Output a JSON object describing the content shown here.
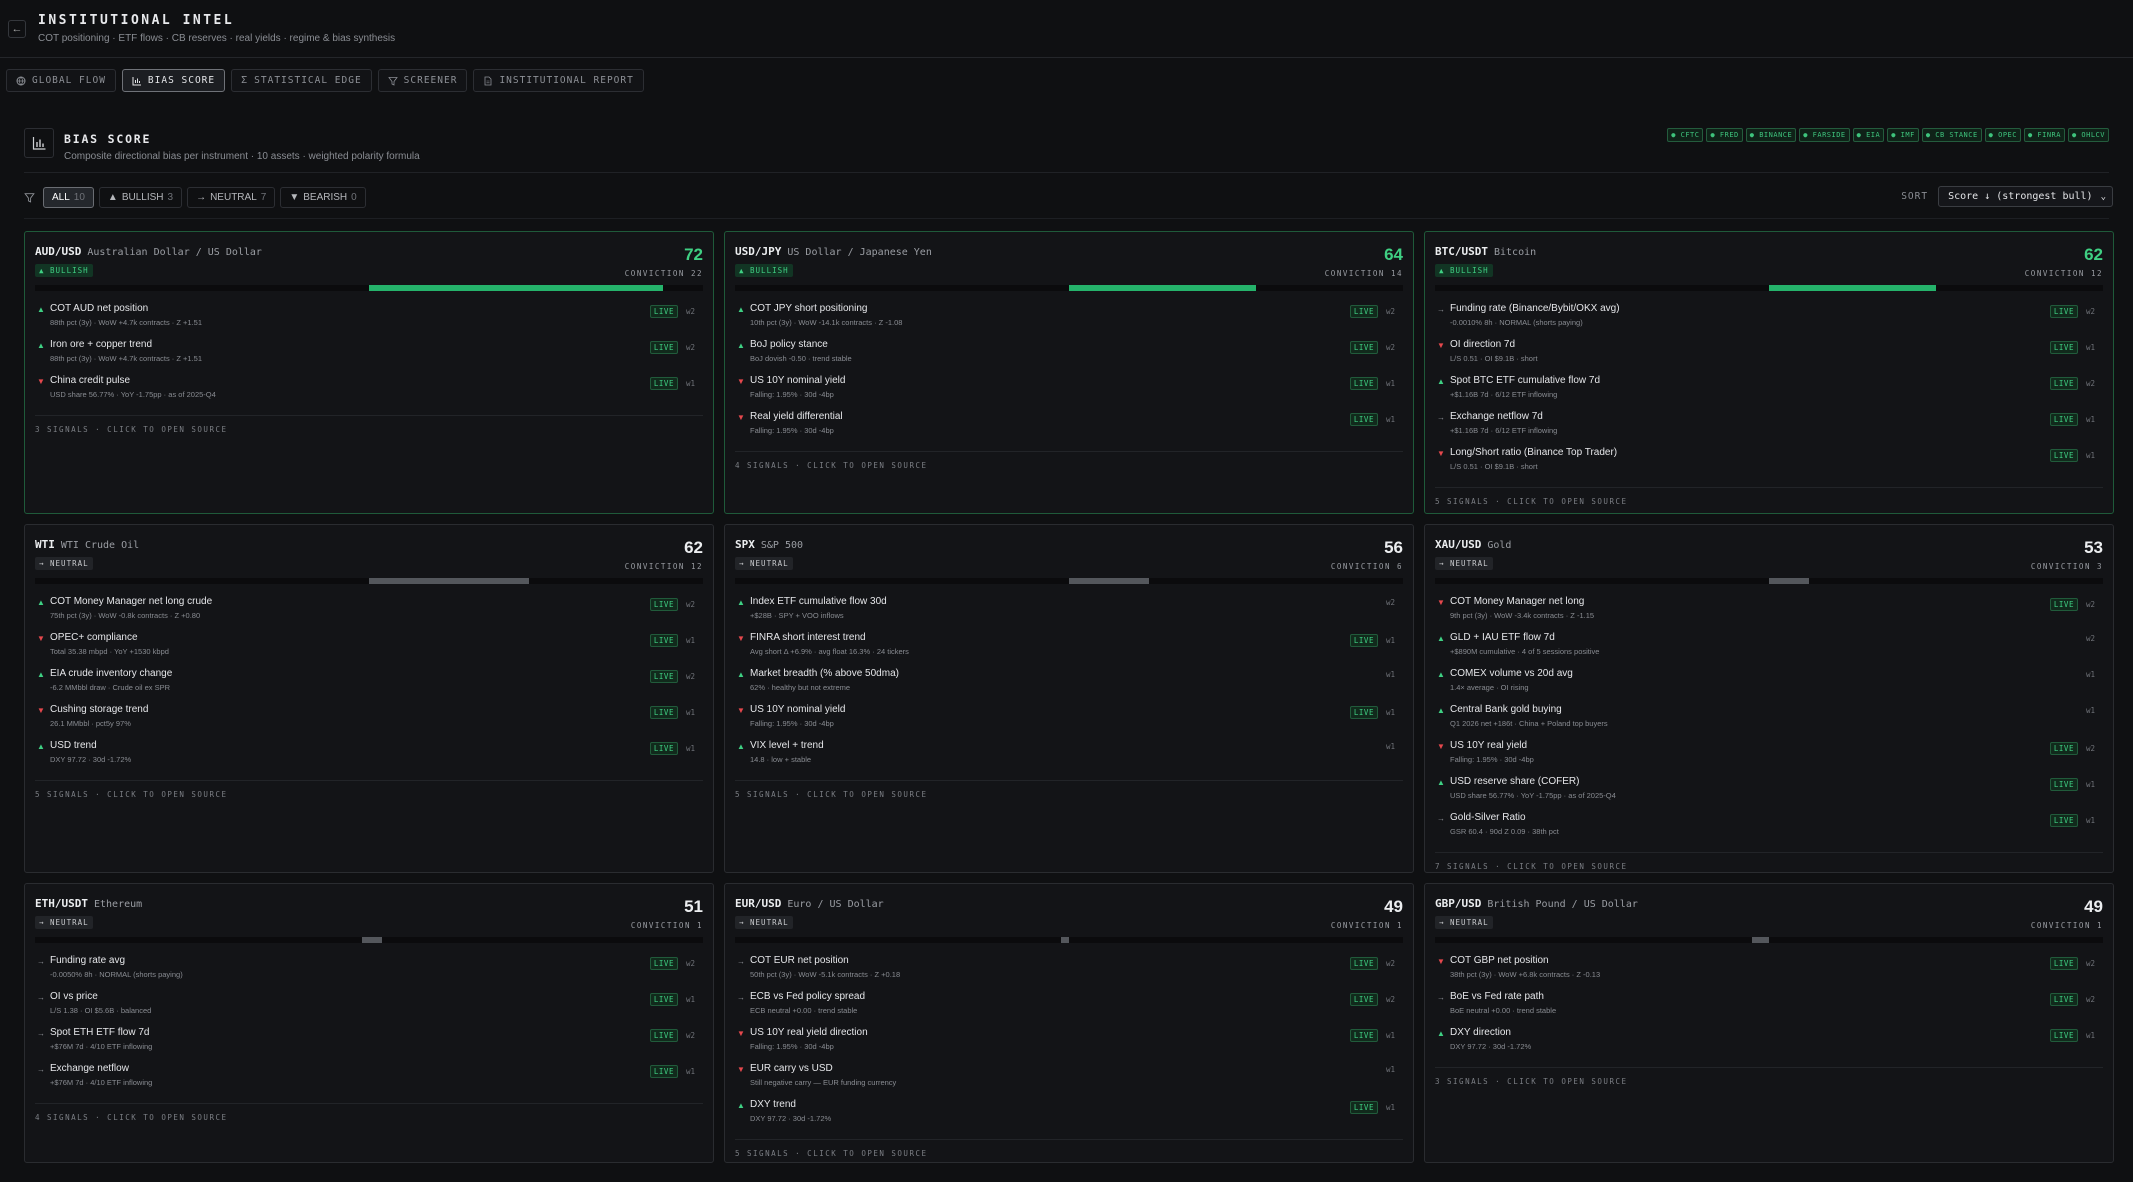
{
  "header": {
    "title": "INSTITUTIONAL INTEL",
    "subtitle": "COT positioning · ETF flows · CB reserves · real yields · regime & bias synthesis"
  },
  "tabs": [
    {
      "label": "GLOBAL FLOW",
      "icon": "globe-icon"
    },
    {
      "label": "BIAS SCORE",
      "icon": "bar-chart-icon"
    },
    {
      "label": "STATISTICAL EDGE",
      "icon": "sigma-icon"
    },
    {
      "label": "SCREENER",
      "icon": "filter-icon"
    },
    {
      "label": "INSTITUTIONAL REPORT",
      "icon": "document-icon"
    }
  ],
  "section": {
    "title": "BIAS SCORE",
    "subtitle": "Composite directional bias per instrument · 10 assets · weighted polarity formula"
  },
  "sources": [
    "● CFTC",
    "● FRED",
    "● BINANCE",
    "● FARSIDE",
    "● EIA",
    "● IMF",
    "● CB STANCE",
    "● OPEC",
    "● FINRA",
    "● OHLCV"
  ],
  "filters": [
    {
      "label": "ALL",
      "count": "10",
      "prefix": ""
    },
    {
      "label": "BULLISH",
      "count": "3",
      "prefix": "▲"
    },
    {
      "label": "NEUTRAL",
      "count": "7",
      "prefix": "→"
    },
    {
      "label": "BEARISH",
      "count": "0",
      "prefix": "▼"
    }
  ],
  "sort": {
    "label": "SORT",
    "value": "Score ↓ (strongest bull)"
  },
  "colors": {
    "bull": "#3fd083",
    "bear": "#e5484d",
    "neutral": "#8a8d93"
  },
  "cards": [
    {
      "sym": "AUD/USD",
      "desc": "Australian Dollar / US Dollar",
      "bias": "▲ BULLISH",
      "score": "72",
      "conviction": "CONVICTION 22",
      "fill": [
        0.5,
        0.94
      ],
      "signals": [
        {
          "dir": "up",
          "name": "COT AUD net position",
          "meta": "88th pct (3y) · WoW +4.7k contracts · Z +1.51",
          "live": "LIVE",
          "w": "w2"
        },
        {
          "dir": "up",
          "name": "Iron ore + copper trend",
          "meta": "88th pct (3y) · WoW +4.7k contracts · Z +1.51",
          "live": "LIVE",
          "w": "w2"
        },
        {
          "dir": "dn",
          "name": "China credit pulse",
          "meta": "USD share 56.77% · YoY -1.75pp · as of 2025-Q4",
          "live": "LIVE",
          "w": "w1"
        }
      ],
      "footer": "3 SIGNALS · CLICK TO OPEN SOURCE"
    },
    {
      "sym": "USD/JPY",
      "desc": "US Dollar / Japanese Yen",
      "bias": "▲ BULLISH",
      "score": "64",
      "conviction": "CONVICTION 14",
      "fill": [
        0.5,
        0.78
      ],
      "signals": [
        {
          "dir": "up",
          "name": "COT JPY short positioning",
          "meta": "10th pct (3y) · WoW -14.1k contracts · Z -1.08",
          "live": "LIVE",
          "w": "w2"
        },
        {
          "dir": "up",
          "name": "BoJ policy stance",
          "meta": "BoJ dovish -0.50 · trend stable",
          "live": "LIVE",
          "w": "w2"
        },
        {
          "dir": "dn",
          "name": "US 10Y nominal yield",
          "meta": "Falling: 1.95% · 30d -4bp",
          "live": "LIVE",
          "w": "w1"
        },
        {
          "dir": "dn",
          "name": "Real yield differential",
          "meta": "Falling: 1.95% · 30d -4bp",
          "live": "LIVE",
          "w": "w1"
        }
      ],
      "footer": "4 SIGNALS · CLICK TO OPEN SOURCE"
    },
    {
      "sym": "BTC/USDT",
      "desc": "Bitcoin",
      "bias": "▲ BULLISH",
      "score": "62",
      "conviction": "CONVICTION 12",
      "fill": [
        0.5,
        0.75
      ],
      "signals": [
        {
          "dir": "fl",
          "name": "Funding rate (Binance/Bybit/OKX avg)",
          "meta": "-0.0010% 8h · NORMAL (shorts paying)",
          "live": "LIVE",
          "w": "w2"
        },
        {
          "dir": "dn",
          "name": "OI direction 7d",
          "meta": "L/S 0.51 · OI $9.1B · short",
          "live": "LIVE",
          "w": "w1"
        },
        {
          "dir": "up",
          "name": "Spot BTC ETF cumulative flow 7d",
          "meta": "+$1.16B 7d · 6/12 ETF inflowing",
          "live": "LIVE",
          "w": "w2"
        },
        {
          "dir": "fl",
          "name": "Exchange netflow 7d",
          "meta": "+$1.16B 7d · 6/12 ETF inflowing",
          "live": "LIVE",
          "w": "w1"
        },
        {
          "dir": "dn",
          "name": "Long/Short ratio (Binance Top Trader)",
          "meta": "L/S 0.51 · OI $9.1B · short",
          "live": "LIVE",
          "w": "w1"
        }
      ],
      "footer": "5 SIGNALS · CLICK TO OPEN SOURCE"
    },
    {
      "sym": "WTI",
      "desc": "WTI Crude Oil",
      "bias": "→ NEUTRAL",
      "score": "62",
      "conviction": "CONVICTION 12",
      "fill": [
        0.5,
        0.74
      ],
      "signals": [
        {
          "dir": "up",
          "name": "COT Money Manager net long crude",
          "meta": "75th pct (3y) · WoW -0.8k contracts · Z +0.80",
          "live": "LIVE",
          "w": "w2"
        },
        {
          "dir": "dn",
          "name": "OPEC+ compliance",
          "meta": "Total 35.38 mbpd · YoY +1530 kbpd",
          "live": "LIVE",
          "w": "w1"
        },
        {
          "dir": "up",
          "name": "EIA crude inventory change",
          "meta": "-6.2 MMbbl draw · Crude oil ex SPR",
          "live": "LIVE",
          "w": "w2"
        },
        {
          "dir": "dn",
          "name": "Cushing storage trend",
          "meta": "26.1 MMbbl · pct5y 97%",
          "live": "LIVE",
          "w": "w1"
        },
        {
          "dir": "up",
          "name": "USD trend",
          "meta": "DXY 97.72 · 30d -1.72%",
          "live": "LIVE",
          "w": "w1"
        }
      ],
      "footer": "5 SIGNALS · CLICK TO OPEN SOURCE"
    },
    {
      "sym": "SPX",
      "desc": "S&P 500",
      "bias": "→ NEUTRAL",
      "score": "56",
      "conviction": "CONVICTION 6",
      "fill": [
        0.5,
        0.62
      ],
      "signals": [
        {
          "dir": "up",
          "name": "Index ETF cumulative flow 30d",
          "meta": "+$28B · SPY + VOO inflows",
          "live": "",
          "w": "w2"
        },
        {
          "dir": "dn",
          "name": "FINRA short interest trend",
          "meta": "Avg short Δ +6.9% · avg float 16.3% · 24 tickers",
          "live": "LIVE",
          "w": "w1"
        },
        {
          "dir": "up",
          "name": "Market breadth (% above 50dma)",
          "meta": "62% · healthy but not extreme",
          "live": "",
          "w": "w1"
        },
        {
          "dir": "dn",
          "name": "US 10Y nominal yield",
          "meta": "Falling: 1.95% · 30d -4bp",
          "live": "LIVE",
          "w": "w1"
        },
        {
          "dir": "up",
          "name": "VIX level + trend",
          "meta": "14.8 · low + stable",
          "live": "",
          "w": "w1"
        }
      ],
      "footer": "5 SIGNALS · CLICK TO OPEN SOURCE"
    },
    {
      "sym": "XAU/USD",
      "desc": "Gold",
      "bias": "→ NEUTRAL",
      "score": "53",
      "conviction": "CONVICTION 3",
      "fill": [
        0.5,
        0.56
      ],
      "signals": [
        {
          "dir": "dn",
          "name": "COT Money Manager net long",
          "meta": "9th pct (3y) · WoW -3.4k contracts · Z -1.15",
          "live": "LIVE",
          "w": "w2"
        },
        {
          "dir": "up",
          "name": "GLD + IAU ETF flow 7d",
          "meta": "+$890M cumulative · 4 of 5 sessions positive",
          "live": "",
          "w": "w2"
        },
        {
          "dir": "up",
          "name": "COMEX volume vs 20d avg",
          "meta": "1.4× average · OI rising",
          "live": "",
          "w": "w1"
        },
        {
          "dir": "up",
          "name": "Central Bank gold buying",
          "meta": "Q1 2026 net +186t · China + Poland top buyers",
          "live": "",
          "w": "w1"
        },
        {
          "dir": "dn",
          "name": "US 10Y real yield",
          "meta": "Falling: 1.95% · 30d -4bp",
          "live": "LIVE",
          "w": "w2"
        },
        {
          "dir": "up",
          "name": "USD reserve share (COFER)",
          "meta": "USD share 56.77% · YoY -1.75pp · as of 2025-Q4",
          "live": "LIVE",
          "w": "w1"
        },
        {
          "dir": "fl",
          "name": "Gold-Silver Ratio",
          "meta": "GSR 60.4 · 90d Z 0.09 · 38th pct",
          "live": "LIVE",
          "w": "w1"
        }
      ],
      "footer": "7 SIGNALS · CLICK TO OPEN SOURCE"
    },
    {
      "sym": "ETH/USDT",
      "desc": "Ethereum",
      "bias": "→ NEUTRAL",
      "score": "51",
      "conviction": "CONVICTION 1",
      "fill": [
        0.49,
        0.52
      ],
      "signals": [
        {
          "dir": "fl",
          "name": "Funding rate avg",
          "meta": "-0.0050% 8h · NORMAL (shorts paying)",
          "live": "LIVE",
          "w": "w2"
        },
        {
          "dir": "fl",
          "name": "OI vs price",
          "meta": "L/S 1.38 · OI $5.6B · balanced",
          "live": "LIVE",
          "w": "w1"
        },
        {
          "dir": "fl",
          "name": "Spot ETH ETF flow 7d",
          "meta": "+$76M 7d · 4/10 ETF inflowing",
          "live": "LIVE",
          "w": "w2"
        },
        {
          "dir": "fl",
          "name": "Exchange netflow",
          "meta": "+$76M 7d · 4/10 ETF inflowing",
          "live": "LIVE",
          "w": "w1"
        }
      ],
      "footer": "4 SIGNALS · CLICK TO OPEN SOURCE"
    },
    {
      "sym": "EUR/USD",
      "desc": "Euro / US Dollar",
      "bias": "→ NEUTRAL",
      "score": "49",
      "conviction": "CONVICTION 1",
      "fill": [
        0.488,
        0.5
      ],
      "signals": [
        {
          "dir": "fl",
          "name": "COT EUR net position",
          "meta": "50th pct (3y) · WoW -5.1k contracts · Z +0.18",
          "live": "LIVE",
          "w": "w2"
        },
        {
          "dir": "fl",
          "name": "ECB vs Fed policy spread",
          "meta": "ECB neutral +0.00 · trend stable",
          "live": "LIVE",
          "w": "w2"
        },
        {
          "dir": "dn",
          "name": "US 10Y real yield direction",
          "meta": "Falling: 1.95% · 30d -4bp",
          "live": "LIVE",
          "w": "w1"
        },
        {
          "dir": "dn",
          "name": "EUR carry vs USD",
          "meta": "Still negative carry — EUR funding currency",
          "live": "",
          "w": "w1"
        },
        {
          "dir": "up",
          "name": "DXY trend",
          "meta": "DXY 97.72 · 30d -1.72%",
          "live": "LIVE",
          "w": "w1"
        }
      ],
      "footer": "5 SIGNALS · CLICK TO OPEN SOURCE"
    },
    {
      "sym": "GBP/USD",
      "desc": "British Pound / US Dollar",
      "bias": "→ NEUTRAL",
      "score": "49",
      "conviction": "CONVICTION 1",
      "fill": [
        0.475,
        0.5
      ],
      "signals": [
        {
          "dir": "dn",
          "name": "COT GBP net position",
          "meta": "38th pct (3y) · WoW +6.8k contracts · Z -0.13",
          "live": "LIVE",
          "w": "w2"
        },
        {
          "dir": "fl",
          "name": "BoE vs Fed rate path",
          "meta": "BoE neutral +0.00 · trend stable",
          "live": "LIVE",
          "w": "w2"
        },
        {
          "dir": "up",
          "name": "DXY direction",
          "meta": "DXY 97.72 · 30d -1.72%",
          "live": "LIVE",
          "w": "w1"
        }
      ],
      "footer": "3 SIGNALS · CLICK TO OPEN SOURCE"
    }
  ]
}
